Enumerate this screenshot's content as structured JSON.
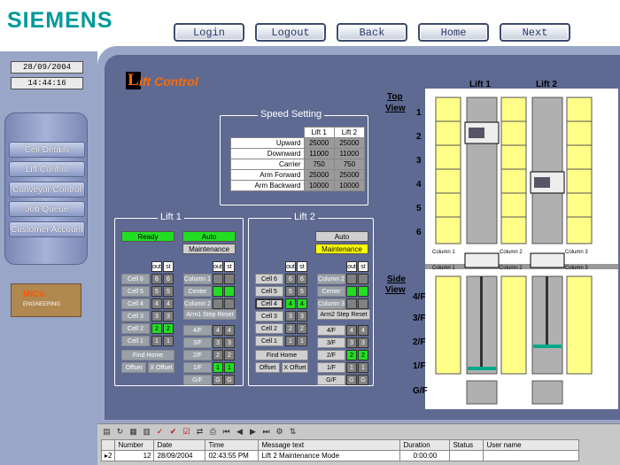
{
  "brand": "SIEMENS",
  "nav": [
    "Login",
    "Logout",
    "Back",
    "Home",
    "Next"
  ],
  "date": "28/09/2004",
  "time": "14:44:16",
  "menu": [
    "Cell Details",
    "Lift Control",
    "Conveyor Control",
    "Job Queue",
    "Customer Account"
  ],
  "logo": {
    "line1": "MiCo",
    "line2": "ENGINEERING"
  },
  "title": {
    "initial": "L",
    "rest": "ift Control"
  },
  "speed": {
    "title": "Speed Setting",
    "headers": [
      "Lift 1",
      "Lift 2"
    ],
    "rows": [
      {
        "label": "Upward",
        "l1": "25000",
        "l2": "25000"
      },
      {
        "label": "Downward",
        "l1": "11000",
        "l2": "11000"
      },
      {
        "label": "Carrier",
        "l1": "750",
        "l2": "750"
      },
      {
        "label": "Arm Forward",
        "l1": "25000",
        "l2": "25000"
      },
      {
        "label": "Arm Backward",
        "l1": "10000",
        "l2": "10000"
      }
    ]
  },
  "lift1": {
    "title": "Lift 1",
    "status": "Ready",
    "mode": "Auto",
    "maint": "Maintenance",
    "out": "out",
    "st": "st",
    "cells": [
      "Cell 6",
      "Cell 5",
      "Cell 4",
      "Cell 3",
      "Cell 2",
      "Cell 1"
    ],
    "cellvals": [
      "6",
      "5",
      "4",
      "3",
      "2",
      "1"
    ],
    "cols": [
      "Column 1",
      "Center",
      "Column 2"
    ],
    "armstep": "Arm1 Step Reset",
    "floors": [
      "4/F",
      "3/F",
      "2/F",
      "1/F",
      "G/F"
    ],
    "floorvals": [
      "4",
      "3",
      "2",
      "1",
      "G"
    ],
    "findhome": "Find Home",
    "offset": "Offset",
    "xoffset": "X Offset"
  },
  "lift2": {
    "title": "Lift 2",
    "mode": "Auto",
    "maint": "Maintenance",
    "out": "out",
    "st": "st",
    "cells": [
      "Cell 6",
      "Cell 5",
      "Cell 4",
      "Cell 3",
      "Cell 2",
      "Cell 1"
    ],
    "cellvals": [
      "6",
      "5",
      "4",
      "3",
      "2",
      "1"
    ],
    "cols": [
      "Column 2",
      "Center",
      "Column 3"
    ],
    "armstep": "Arm2 Step Reset",
    "floors": [
      "4/F",
      "3/F",
      "2/F",
      "1/F",
      "G/F"
    ],
    "floorvals": [
      "4",
      "3",
      "2",
      "1",
      "G"
    ],
    "findhome": "Find Home",
    "offset": "Offset",
    "xoffset": "X Offset"
  },
  "topview": {
    "label1": "Top",
    "label2": "View",
    "lift1": "Lift 1",
    "lift2": "Lift 2",
    "rows": [
      "1",
      "2",
      "3",
      "4",
      "5",
      "6"
    ],
    "cols": [
      "Column 1",
      "Column 2",
      "Column 3"
    ]
  },
  "sideview": {
    "label1": "Side",
    "label2": "View",
    "floors": [
      "4/F",
      "3/F",
      "2/F",
      "1/F",
      "G/F"
    ],
    "cols": [
      "Column 1",
      "Column 2",
      "Column 3"
    ]
  },
  "log": {
    "headers": [
      "",
      "Number",
      "Date",
      "Time",
      "Message text",
      "Duration",
      "Status",
      "User name"
    ],
    "row": {
      "mark": "2",
      "number": "12",
      "date": "28/09/2004",
      "time": "02:43:55 PM",
      "message": "Lift 2 Maintenance Mode",
      "duration": "0:00:00",
      "status": "",
      "user": ""
    }
  },
  "colors": {
    "teal": "#009999",
    "orange": "#ff6a00",
    "green": "#22dd22",
    "yellow": "#ffff00",
    "panel": "#5e6a92"
  }
}
